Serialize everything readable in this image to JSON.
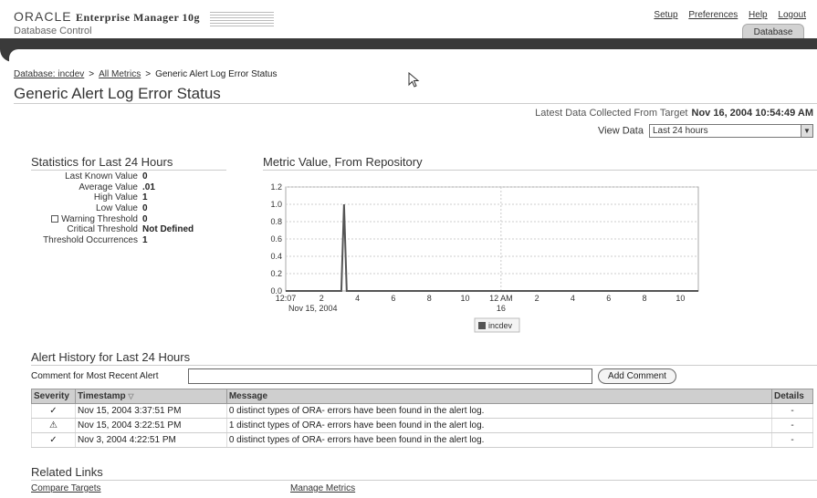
{
  "header": {
    "brand_oracle": "ORACLE",
    "brand_em": "Enterprise Manager 10g",
    "brand_sub": "Database Control",
    "global_links": [
      "Setup",
      "Preferences",
      "Help",
      "Logout"
    ],
    "tab": "Database"
  },
  "breadcrumb": {
    "items": [
      "Database: incdev",
      "All Metrics",
      "Generic Alert Log Error Status"
    ],
    "separator": ">"
  },
  "page_title": "Generic Alert Log Error Status",
  "collected": {
    "label": "Latest Data Collected From Target",
    "value": "Nov 16, 2004 10:54:49 AM"
  },
  "view_data": {
    "label": "View Data",
    "selected": "Last 24 hours"
  },
  "stats": {
    "title": "Statistics for Last 24 Hours",
    "rows": [
      {
        "label": "Last Known Value",
        "value": "0"
      },
      {
        "label": "Average Value",
        "value": ".01"
      },
      {
        "label": "High Value",
        "value": "1"
      },
      {
        "label": "Low Value",
        "value": "0"
      },
      {
        "label": "Warning Threshold",
        "value": "0"
      },
      {
        "label": "Critical Threshold",
        "value": "Not Defined"
      },
      {
        "label": "Threshold Occurrences",
        "value": "1"
      }
    ]
  },
  "chart_title": "Metric Value, From Repository",
  "chart_data": {
    "type": "line",
    "title": "Metric Value, From Repository",
    "x_tick_labels": [
      "12:07",
      "2",
      "4",
      "6",
      "8",
      "10",
      "12 AM",
      "2",
      "4",
      "6",
      "8",
      "10"
    ],
    "x_sublabels": [
      "Nov 15, 2004",
      "16"
    ],
    "y_tick_labels": [
      "0.0",
      "0.2",
      "0.4",
      "0.6",
      "0.8",
      "1.0",
      "1.2"
    ],
    "ylim": [
      0,
      1.2
    ],
    "xlim_hours": [
      0,
      23
    ],
    "grid": true,
    "legend_position": "bottom",
    "series": [
      {
        "name": "incdev",
        "color": "#555555",
        "x_hours": [
          0,
          3.1,
          3.25,
          3.4,
          23
        ],
        "values": [
          0,
          0,
          1,
          0,
          0
        ]
      }
    ]
  },
  "alerts": {
    "title": "Alert History for Last 24 Hours",
    "comment_label": "Comment for Most Recent Alert",
    "add_comment": "Add Comment",
    "columns": [
      "Severity",
      "Timestamp",
      "Message",
      "Details"
    ],
    "rows": [
      {
        "severity": "clear",
        "icon": "✓",
        "timestamp": "Nov 15, 2004 3:37:51 PM",
        "message": "0 distinct types of ORA- errors have been found in the alert log.",
        "details": "-"
      },
      {
        "severity": "warning",
        "icon": "⚠",
        "timestamp": "Nov 15, 2004 3:22:51 PM",
        "message": "1 distinct types of ORA- errors have been found in the alert log.",
        "details": "-"
      },
      {
        "severity": "clear",
        "icon": "✓",
        "timestamp": "Nov 3, 2004 4:22:51 PM",
        "message": "0 distinct types of ORA- errors have been found in the alert log.",
        "details": "-"
      }
    ]
  },
  "related": {
    "title": "Related Links",
    "links": [
      "Compare Targets",
      "Manage Metrics"
    ]
  }
}
